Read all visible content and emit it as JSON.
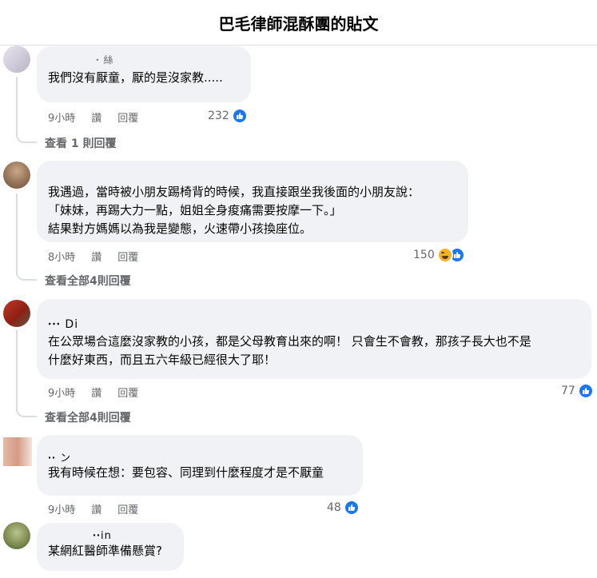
{
  "page": {
    "title": "巴毛律師混酥團的貼文"
  },
  "comments": [
    {
      "author": "ꞏ 絲",
      "text": "我們沒有厭童，厭的是沒家教.....",
      "time": "9小時",
      "like": "讚",
      "reply": "回覆",
      "reactions": "232",
      "view_replies": "查看 1 則回覆"
    },
    {
      "author": "",
      "text": "我遇過，當時被小朋友踢椅背的時候，我直接跟坐我後面的小朋友說：\n「妹妹，再踢大力一點，姐姐全身痠痛需要按摩一下。」\n結果對方媽媽以為我是變態，火速帶小孩換座位。",
      "time": "8小時",
      "like": "讚",
      "reply": "回覆",
      "reactions": "150",
      "view_replies": "查看全部4則回覆"
    },
    {
      "author": "ꞏꞏꞏ Di",
      "text": "在公眾場合這麼沒家教的小孩，都是父母教育出來的啊！ 只會生不會教，那孩子長大也不是\n什麼好東西，而且五六年級已經很大了耶！",
      "time": "9小時",
      "like": "讚",
      "reply": "回覆",
      "reactions": "77",
      "view_replies": "查看全部4則回覆"
    },
    {
      "author": "ꞏꞏ ン",
      "text": "我有時候在想：要包容、同理到什麼程度才是不厭童",
      "time": "9小時",
      "like": "讚",
      "reply": "回覆",
      "reactions": "48"
    },
    {
      "author": "ꞏꞏin",
      "text": "某網紅醫師準備懸賞?"
    }
  ],
  "colors": {
    "like_blue": "#1877f2",
    "bubble_bg": "#f0f2f5",
    "meta_gray": "#65676b"
  }
}
